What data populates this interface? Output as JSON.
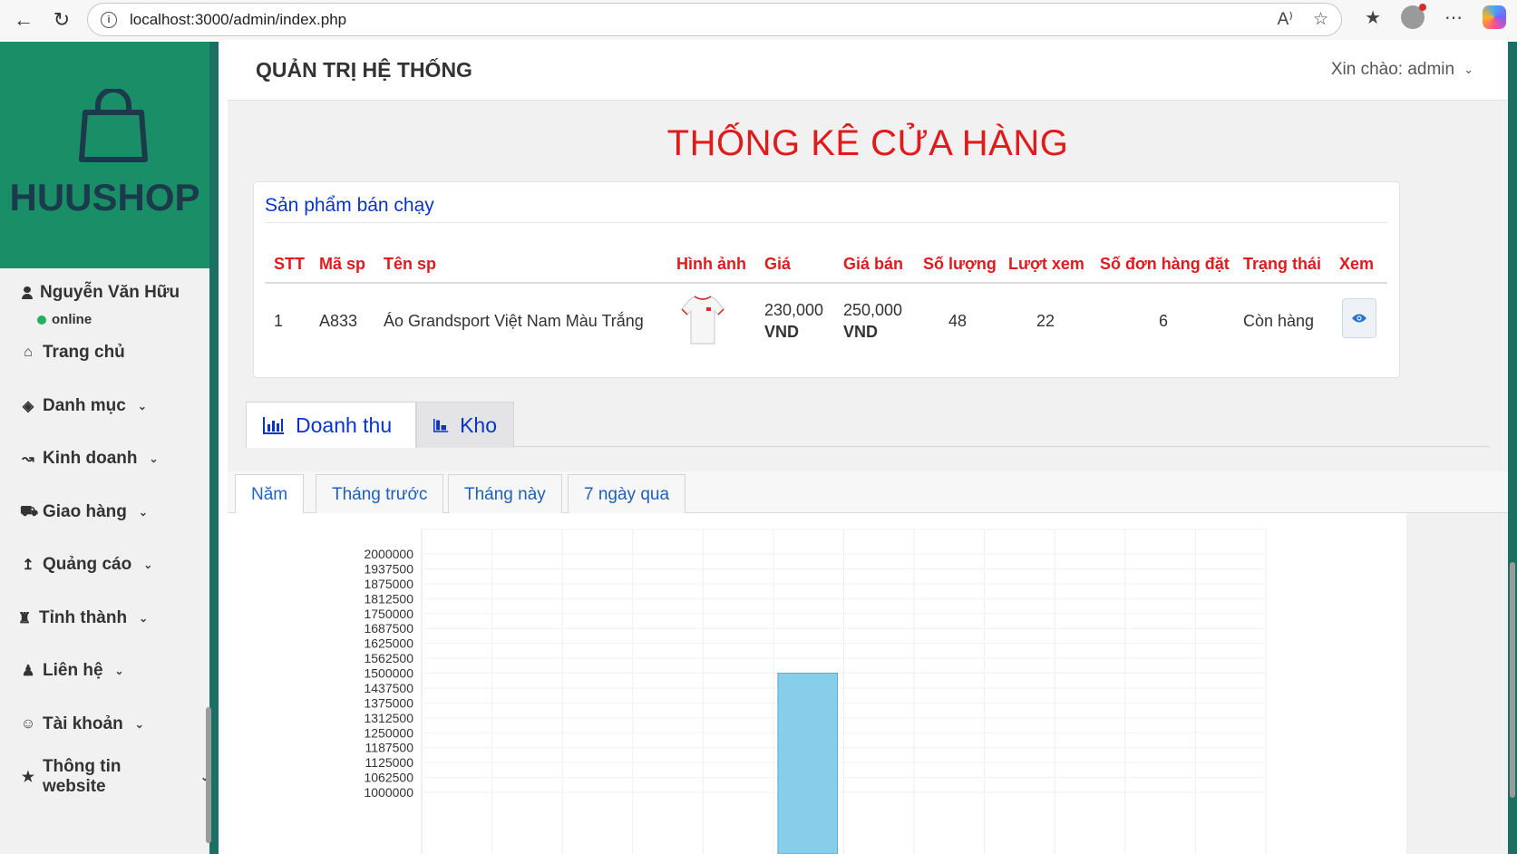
{
  "browser": {
    "url": "localhost:3000/admin/index.php"
  },
  "sidebar": {
    "brand": "HUUSHOP",
    "user_name": "Nguyễn Văn Hữu",
    "user_status": "online",
    "items": [
      {
        "label": "Trang chủ",
        "icon": "home-icon"
      },
      {
        "label": "Danh mục",
        "icon": "tags-icon"
      },
      {
        "label": "Kinh doanh",
        "icon": "line-chart-icon"
      },
      {
        "label": "Giao hàng",
        "icon": "truck-icon"
      },
      {
        "label": "Quảng cáo",
        "icon": "upload-icon"
      },
      {
        "label": "Tỉnh thành",
        "icon": "castle-icon"
      },
      {
        "label": "Liên hệ",
        "icon": "person-icon"
      },
      {
        "label": "Tài khoản",
        "icon": "users-icon"
      },
      {
        "label": "Thông tin website",
        "icon": "star-icon"
      }
    ]
  },
  "header": {
    "title": "QUẢN TRỊ HỆ THỐNG",
    "greeting": "Xin chào: admin"
  },
  "main": {
    "heading": "THỐNG KÊ CỬA HÀNG",
    "panel_title": "Sản phẩm bán chạy",
    "columns": [
      "STT",
      "Mã sp",
      "Tên sp",
      "Hình ảnh",
      "Giá",
      "Giá bán",
      "Số lượng",
      "Lượt xem",
      "Số đơn hàng đặt",
      "Trạng thái",
      "Xem"
    ],
    "rows": [
      {
        "stt": "1",
        "code": "A833",
        "name": "Áo Grandsport Việt Nam Màu Trắng",
        "price": "230,000",
        "price_unit": "VND",
        "sale_price": "250,000",
        "sale_unit": "VND",
        "quantity": "48",
        "views": "22",
        "orders": "6",
        "status": "Còn hàng"
      }
    ],
    "tabs": [
      {
        "label": "Doanh thu",
        "icon": "bar-chart-icon"
      },
      {
        "label": "Kho",
        "icon": "warehouse-chart-icon"
      }
    ],
    "subtabs": [
      "Năm",
      "Tháng trước",
      "Tháng này",
      "7 ngày qua"
    ]
  },
  "chart_data": {
    "type": "bar",
    "title": "",
    "xlabel": "",
    "ylabel": "",
    "yticks": [
      2000000,
      1937500,
      1875000,
      1812500,
      1750000,
      1687500,
      1625000,
      1562500,
      1500000,
      1437500,
      1375000,
      1312500,
      1250000,
      1187500,
      1125000,
      1062500,
      1000000
    ],
    "ylim": [
      1000000,
      2000000
    ],
    "bar_color": "#87ceeb",
    "bar_border": "#5aa9d6",
    "grid": true,
    "series": [
      {
        "values": [
          null,
          null,
          null,
          null,
          null,
          1500000,
          null,
          null,
          null,
          null,
          null,
          null
        ]
      }
    ]
  }
}
